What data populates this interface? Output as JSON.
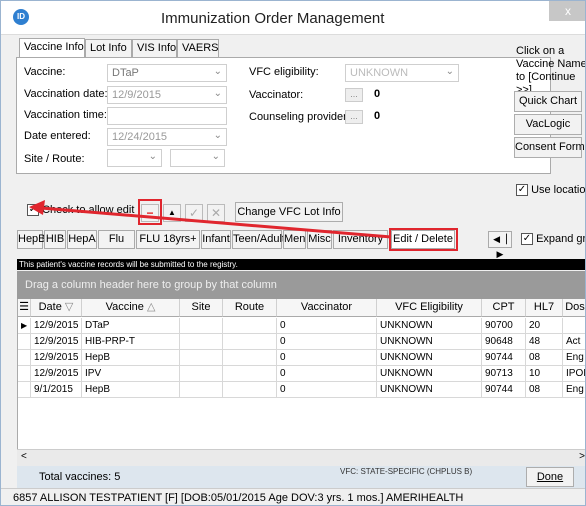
{
  "window": {
    "title": "Immunization Order Management",
    "close": "x",
    "app_logo": "ID"
  },
  "tabs": [
    "Vaccine Info",
    "Lot Info",
    "VIS Info",
    "VAERS"
  ],
  "form": {
    "vaccine_label": "Vaccine:",
    "vaccine_value": "DTaP",
    "vaccination_date_label": "Vaccination date:",
    "vaccination_date_value": "12/9/2015",
    "vaccination_time_label": "Vaccination time:",
    "date_entered_label": "Date entered:",
    "date_entered_value": "12/24/2015",
    "site_route_label": "Site / Route:",
    "vfc_label": "VFC eligibility:",
    "vfc_value": "UNKNOWN",
    "vaccinator_label": "Vaccinator:",
    "vaccinator_count": "0",
    "counseling_label": "Counseling provider:",
    "counseling_count": "0",
    "ellipsis": "..."
  },
  "right_panel": {
    "note": "Click on a Vaccine Name to [Continue >>]",
    "quick_chart": "Quick Chart",
    "vaclogic": "VacLogic",
    "consent_form": "Consent Form",
    "use_location": "Use location"
  },
  "edit_row": {
    "check_label": "Check to allow edit",
    "minus": "−",
    "up": "▲",
    "ok": "✓",
    "cancel": "✕",
    "change_vfc": "Change VFC Lot Info"
  },
  "categories": [
    "HepB",
    "HIB",
    "HepA",
    "Flu",
    "FLU 18yrs+",
    "Infant",
    "Teen/Adult",
    "Men",
    "Misc",
    "Inventory",
    "Edit / Delete"
  ],
  "expand_grid": "Expand grid",
  "registry_note": "This patient's vaccine records will be submitted to the registry.",
  "group_hint": "Drag a column header here to group by that column",
  "grid": {
    "headers": [
      "Date",
      "Vaccine",
      "Site",
      "Route",
      "Vaccinator",
      "VFC Eligibility",
      "CPT",
      "HL7",
      "Dos"
    ],
    "rows": [
      {
        "date": "12/9/2015",
        "vaccine": "DTaP",
        "site": "",
        "route": "",
        "vaccinator": "0",
        "vfc": "UNKNOWN",
        "cpt": "90700",
        "hl7": "20",
        "dos": ""
      },
      {
        "date": "12/9/2015",
        "vaccine": "HIB-PRP-T",
        "site": "",
        "route": "",
        "vaccinator": "0",
        "vfc": "UNKNOWN",
        "cpt": "90648",
        "hl7": "48",
        "dos": "Act"
      },
      {
        "date": "12/9/2015",
        "vaccine": "HepB",
        "site": "",
        "route": "",
        "vaccinator": "0",
        "vfc": "UNKNOWN",
        "cpt": "90744",
        "hl7": "08",
        "dos": "Eng"
      },
      {
        "date": "12/9/2015",
        "vaccine": "IPV",
        "site": "",
        "route": "",
        "vaccinator": "0",
        "vfc": "UNKNOWN",
        "cpt": "90713",
        "hl7": "10",
        "dos": "IPOI"
      },
      {
        "date": "9/1/2015",
        "vaccine": "HepB",
        "site": "",
        "route": "",
        "vaccinator": "0",
        "vfc": "UNKNOWN",
        "cpt": "90744",
        "hl7": "08",
        "dos": "Eng"
      }
    ]
  },
  "footer": {
    "total": "Total vaccines: 5",
    "vfc_state": "VFC: STATE-SPECIFIC (CHPLUS B)",
    "done": "Done"
  },
  "status": "6857 ALLISON TESTPATIENT [F] [DOB:05/01/2015 Age DOV:3 yrs. 1 mos.] AMERIHEALTH"
}
